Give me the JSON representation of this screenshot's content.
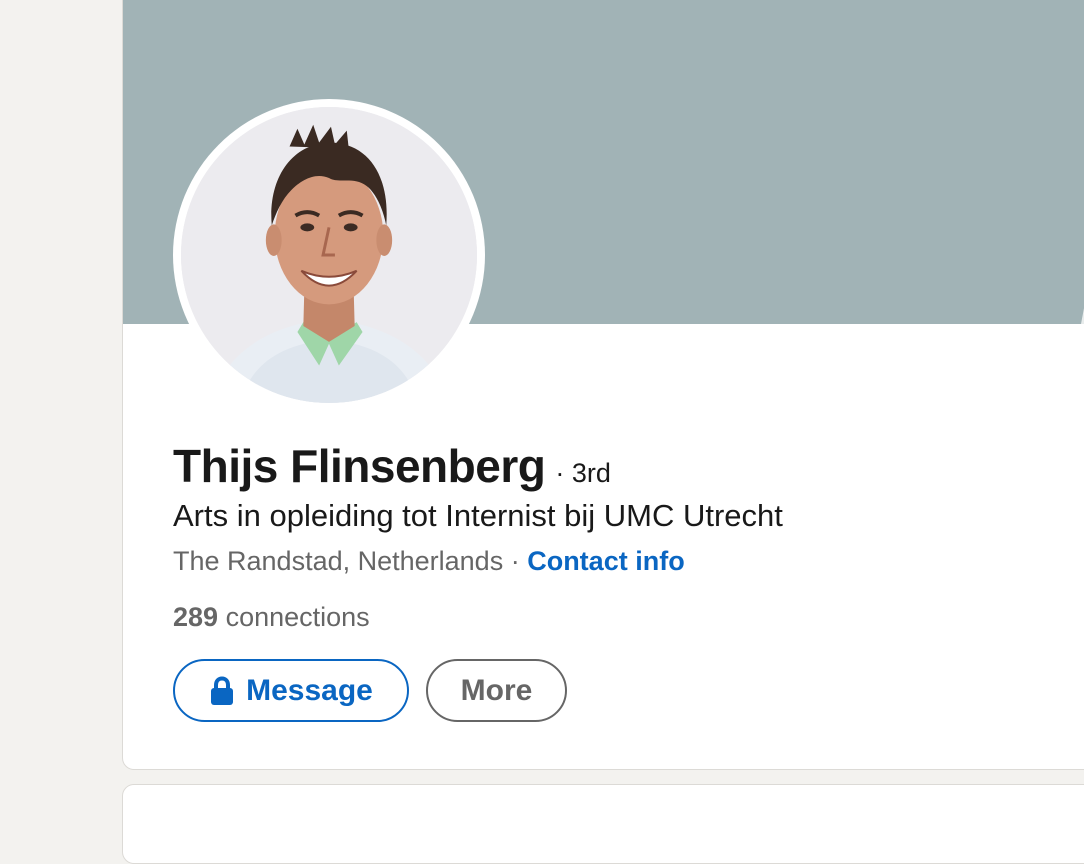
{
  "profile": {
    "name": "Thijs Flinsenberg",
    "degree": "· 3rd",
    "headline": "Arts in opleiding tot Internist bij UMC Utrecht",
    "location": "The Randstad, Netherlands",
    "location_separator": " · ",
    "contact_info_label": "Contact info",
    "connections_count": "289",
    "connections_label": "connections"
  },
  "actions": {
    "message_label": "Message",
    "more_label": "More"
  },
  "icons": {
    "message": "lock-icon"
  },
  "colors": {
    "page_background": "#f3f2ef",
    "banner": "#a1b3b6",
    "link_blue": "#0a66c2",
    "text_primary": "#191919",
    "text_secondary": "#666666"
  }
}
